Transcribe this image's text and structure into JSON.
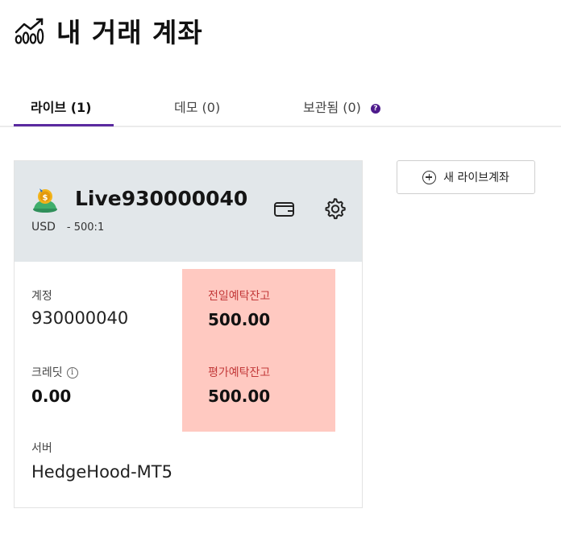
{
  "header": {
    "title": "내 거래 계좌",
    "icon": "growth-chart-icon"
  },
  "tabs": [
    {
      "label": "라이브 (1)",
      "active": true
    },
    {
      "label": "데모 (0)",
      "active": false
    },
    {
      "label": "보관됨 (0)",
      "active": false
    }
  ],
  "tab_help_badge": "?",
  "new_account_button": {
    "label": "새 라이브계좌",
    "icon": "plus-circle-icon"
  },
  "account": {
    "name": "Live930000040",
    "currency": "USD",
    "leverage": "- 500:1",
    "platform_icon": "metatrader5-icon",
    "fields": {
      "account_label": "계정",
      "account_value": "930000040",
      "prev_balance_label": "전일예탁잔고",
      "prev_balance_value": "500.00",
      "credit_label": "크레딧",
      "credit_value": "0.00",
      "eval_balance_label": "평가예탁잔고",
      "eval_balance_value": "500.00",
      "server_label": "서버",
      "server_value": "HedgeHood-MT5"
    }
  },
  "colors": {
    "accent": "#5a2aa0",
    "card_header": "#e2e7ea",
    "highlight": "#ffc9c1"
  }
}
